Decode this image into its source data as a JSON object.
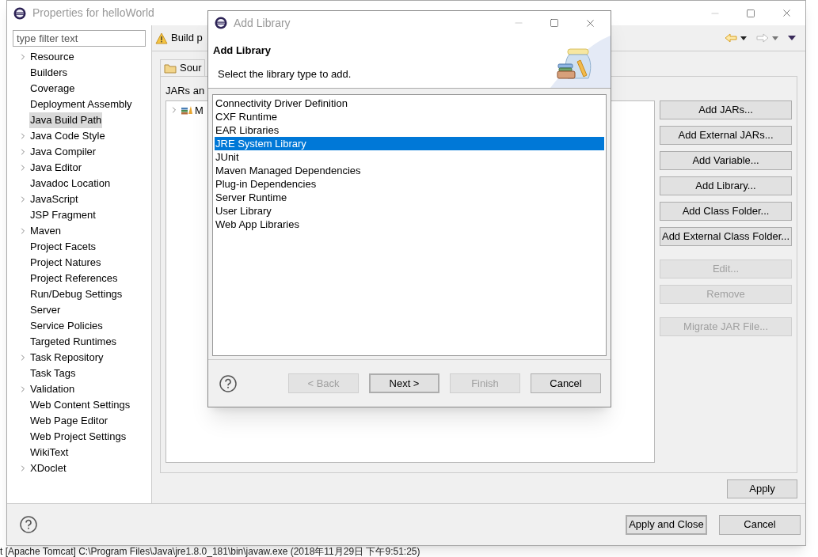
{
  "window": {
    "title": "Properties for helloWorld"
  },
  "filter": {
    "placeholder": "type filter text"
  },
  "sidebar": {
    "items": [
      {
        "label": "Resource",
        "expandable": true,
        "selected": false
      },
      {
        "label": "Builders",
        "expandable": false,
        "selected": false
      },
      {
        "label": "Coverage",
        "expandable": false,
        "selected": false
      },
      {
        "label": "Deployment Assembly",
        "expandable": false,
        "selected": false
      },
      {
        "label": "Java Build Path",
        "expandable": false,
        "selected": true
      },
      {
        "label": "Java Code Style",
        "expandable": true,
        "selected": false
      },
      {
        "label": "Java Compiler",
        "expandable": true,
        "selected": false
      },
      {
        "label": "Java Editor",
        "expandable": true,
        "selected": false
      },
      {
        "label": "Javadoc Location",
        "expandable": false,
        "selected": false
      },
      {
        "label": "JavaScript",
        "expandable": true,
        "selected": false
      },
      {
        "label": "JSP Fragment",
        "expandable": false,
        "selected": false
      },
      {
        "label": "Maven",
        "expandable": true,
        "selected": false
      },
      {
        "label": "Project Facets",
        "expandable": false,
        "selected": false
      },
      {
        "label": "Project Natures",
        "expandable": false,
        "selected": false
      },
      {
        "label": "Project References",
        "expandable": false,
        "selected": false
      },
      {
        "label": "Run/Debug Settings",
        "expandable": false,
        "selected": false
      },
      {
        "label": "Server",
        "expandable": false,
        "selected": false
      },
      {
        "label": "Service Policies",
        "expandable": false,
        "selected": false
      },
      {
        "label": "Targeted Runtimes",
        "expandable": false,
        "selected": false
      },
      {
        "label": "Task Repository",
        "expandable": true,
        "selected": false
      },
      {
        "label": "Task Tags",
        "expandable": false,
        "selected": false
      },
      {
        "label": "Validation",
        "expandable": true,
        "selected": false
      },
      {
        "label": "Web Content Settings",
        "expandable": false,
        "selected": false
      },
      {
        "label": "Web Page Editor",
        "expandable": false,
        "selected": false
      },
      {
        "label": "Web Project Settings",
        "expandable": false,
        "selected": false
      },
      {
        "label": "WikiText",
        "expandable": false,
        "selected": false
      },
      {
        "label": "XDoclet",
        "expandable": true,
        "selected": false
      }
    ]
  },
  "page": {
    "title": "Build p",
    "tab": "Sour",
    "section_label": "JARs an",
    "tree_item": "M",
    "button_groups": [
      [
        {
          "label": "Add JARs...",
          "disabled": false
        },
        {
          "label": "Add External JARs...",
          "disabled": false
        },
        {
          "label": "Add Variable...",
          "disabled": false
        },
        {
          "label": "Add Library...",
          "disabled": false
        },
        {
          "label": "Add Class Folder...",
          "disabled": false
        },
        {
          "label": "Add External Class Folder...",
          "disabled": false
        }
      ],
      [
        {
          "label": "Edit...",
          "disabled": true
        },
        {
          "label": "Remove",
          "disabled": true
        }
      ],
      [
        {
          "label": "Migrate JAR File...",
          "disabled": true
        }
      ]
    ],
    "apply_button": "Apply"
  },
  "footer": {
    "buttons": [
      {
        "label": "Apply and Close",
        "default": true
      },
      {
        "label": "Cancel",
        "default": false
      }
    ]
  },
  "dialog": {
    "title": "Add Library",
    "heading": "Add Library",
    "message": "Select the library type to add.",
    "library_types": [
      {
        "label": "Connectivity Driver Definition",
        "selected": false
      },
      {
        "label": "CXF Runtime",
        "selected": false
      },
      {
        "label": "EAR Libraries",
        "selected": false
      },
      {
        "label": "JRE System Library",
        "selected": true
      },
      {
        "label": "JUnit",
        "selected": false
      },
      {
        "label": "Maven Managed Dependencies",
        "selected": false
      },
      {
        "label": "Plug-in Dependencies",
        "selected": false
      },
      {
        "label": "Server Runtime",
        "selected": false
      },
      {
        "label": "User Library",
        "selected": false
      },
      {
        "label": "Web App Libraries",
        "selected": false
      }
    ],
    "buttons": [
      {
        "label": "< Back",
        "disabled": true,
        "default": false
      },
      {
        "label": "Next >",
        "disabled": false,
        "default": true
      },
      {
        "label": "Finish",
        "disabled": true,
        "default": false
      },
      {
        "label": "Cancel",
        "disabled": false,
        "default": false
      }
    ]
  },
  "console_line": "t [Apache Tomcat] C:\\Program Files\\Java\\jre1.8.0_181\\bin\\javaw.exe (2018年11月29日 下午9:51:25)"
}
